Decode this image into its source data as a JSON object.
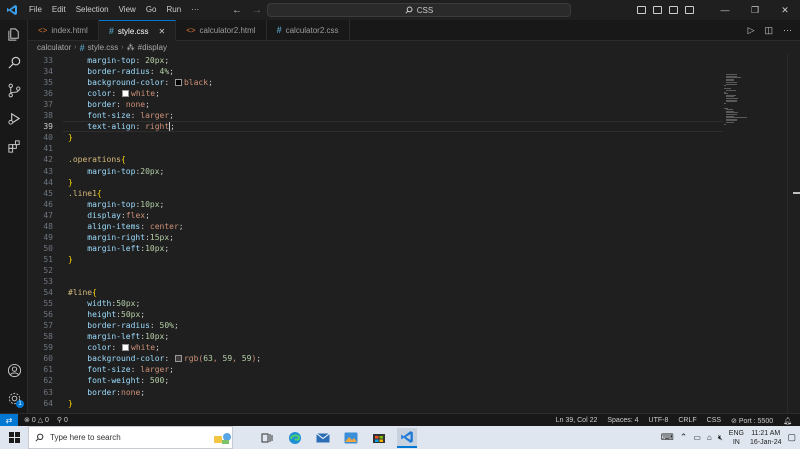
{
  "titlebar": {
    "menu": [
      "File",
      "Edit",
      "Selection",
      "View",
      "Go",
      "Run",
      "···"
    ],
    "search_text": "CSS"
  },
  "tabs": [
    {
      "label": "index.html",
      "icon": "html-file-icon",
      "active": false
    },
    {
      "label": "style.css",
      "icon": "css-file-icon",
      "active": true
    },
    {
      "label": "calculator2.html",
      "icon": "html-file-icon",
      "active": false
    },
    {
      "label": "calculator2.css",
      "icon": "css-file-icon",
      "active": false
    }
  ],
  "breadcrumb": {
    "folder": "calculator",
    "file": "style.css",
    "symbol": "#display"
  },
  "editor": {
    "current_line": 39,
    "lines": [
      {
        "n": "33",
        "code": "    margin-top: 20px;"
      },
      {
        "n": "34",
        "code": "    border-radius: 4%;"
      },
      {
        "n": "35",
        "code": "    background-color: black;"
      },
      {
        "n": "36",
        "code": "    color: white;"
      },
      {
        "n": "37",
        "code": "    border: none;"
      },
      {
        "n": "38",
        "code": "    font-size: larger;"
      },
      {
        "n": "39",
        "code": "    text-align: right;"
      },
      {
        "n": "40",
        "code": "}"
      },
      {
        "n": "41",
        "code": ""
      },
      {
        "n": "42",
        "code": ".operations{"
      },
      {
        "n": "43",
        "code": "    margin-top:20px;"
      },
      {
        "n": "44",
        "code": "}"
      },
      {
        "n": "45",
        "code": ".line1{"
      },
      {
        "n": "46",
        "code": "    margin-top:10px;"
      },
      {
        "n": "47",
        "code": "    display:flex;"
      },
      {
        "n": "48",
        "code": "    align-items: center;"
      },
      {
        "n": "49",
        "code": "    margin-right:15px;"
      },
      {
        "n": "50",
        "code": "    margin-left:10px;"
      },
      {
        "n": "51",
        "code": "}"
      },
      {
        "n": "52",
        "code": ""
      },
      {
        "n": "53",
        "code": ""
      },
      {
        "n": "54",
        "code": "#line{"
      },
      {
        "n": "55",
        "code": "    width:50px;"
      },
      {
        "n": "56",
        "code": "    height:50px;"
      },
      {
        "n": "57",
        "code": "    border-radius: 50%;"
      },
      {
        "n": "58",
        "code": "    margin-left:10px;"
      },
      {
        "n": "59",
        "code": "    color: white;"
      },
      {
        "n": "60",
        "code": "    background-color: rgb(63, 59, 59);"
      },
      {
        "n": "61",
        "code": "    font-size: larger;"
      },
      {
        "n": "62",
        "code": "    font-weight: 500;"
      },
      {
        "n": "63",
        "code": "    border:none;"
      },
      {
        "n": "64",
        "code": "}"
      }
    ]
  },
  "statusbar": {
    "errors": "0",
    "warnings": "0",
    "ports": "0",
    "position": "Ln 39, Col 22",
    "spaces": "Spaces: 4",
    "encoding": "UTF-8",
    "eol": "CRLF",
    "language": "CSS",
    "port": "Port : 5500",
    "accent": "#0078d4"
  },
  "activity_badge": "1",
  "taskbar": {
    "search_placeholder": "Type here to search",
    "lang_top": "ENG",
    "lang_bottom": "IN",
    "time": "11:21 AM",
    "date": "16-Jan-24"
  }
}
